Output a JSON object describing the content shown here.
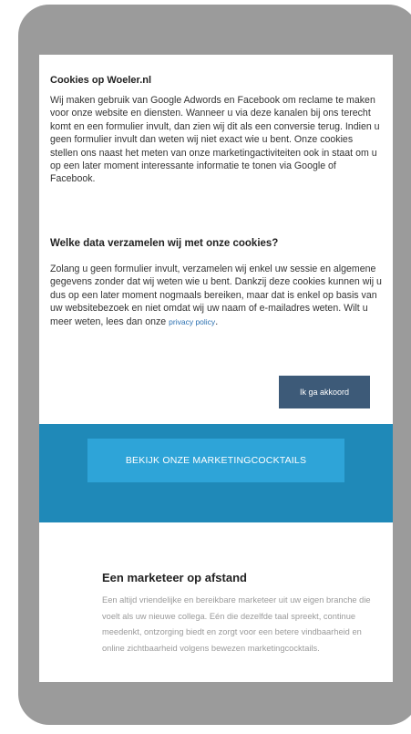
{
  "cookie_modal": {
    "title": "Cookies op Woeler.nl",
    "paragraph1": "Wij maken gebruik van Google Adwords en Facebook om reclame te maken voor onze website en diensten. Wanneer u via deze kanalen bij ons terecht komt en een formulier invult, dan zien wij dit als een conversie terug. Indien u geen formulier invult dan weten wij niet exact wie u bent. Onze cookies stellen ons naast het meten van onze marketingactiviteiten ook in staat om u op een later moment interessante informatie te tonen via Google of Facebook.",
    "heading2": "Welke data verzamelen wij met onze cookies?",
    "paragraph2": "Zolang u geen formulier invult, verzamelen wij enkel uw sessie en algemene gegevens zonder dat wij weten wie u bent. Dankzij deze cookies kunnen wij u dus op een later moment nogmaals bereiken, maar dat is enkel op basis van uw websitebezoek en niet omdat wij uw naam of e-mailadres weten. Wilt u meer weten, lees dan onze",
    "privacy_link": "privacy policy",
    "paragraph2_end": ".",
    "accept_label": "Ik ga akkoord"
  },
  "cta": {
    "label": "BEKIJK ONZE MARKETINGCOCKTAILS"
  },
  "section": {
    "title": "Een marketeer op afstand",
    "text": "Een altijd vriendelijke en bereikbare marketeer uit uw eigen branche die voelt als uw nieuwe collega. Eén die dezelfde taal spreekt, continue meedenkt, ontzorging biedt en zorgt voor een betere vindbaarheid en online zichtbaarheid volgens bewezen marketingcocktails."
  },
  "colors": {
    "accent": "#1f89b8",
    "button": "#3d5a78",
    "cta": "#2ea4d8",
    "device": "#9b9b9b"
  }
}
